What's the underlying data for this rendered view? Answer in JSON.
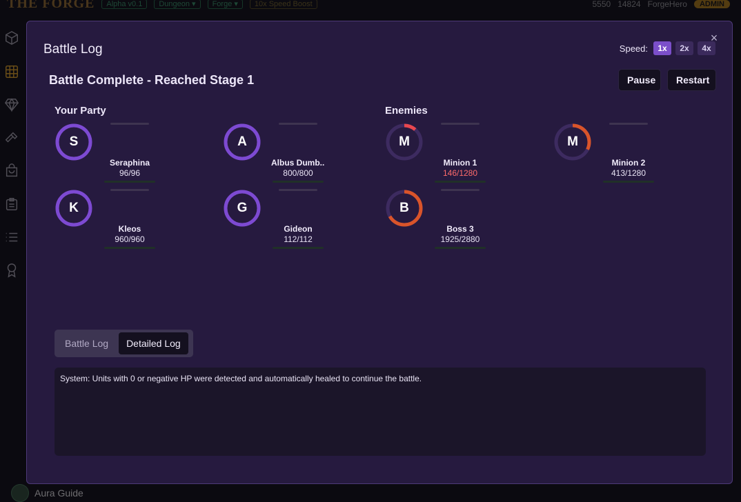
{
  "app": {
    "logo": "THE FORGE",
    "chips": [
      "Alpha v0.1",
      "Dungeon ▾",
      "Forge ▾",
      "10x Speed Boost"
    ],
    "gold": "5550",
    "gems": "14824",
    "user": "ForgeHero",
    "role_badge": "ADMIN",
    "guide_label": "Aura Guide"
  },
  "sidebar": {
    "items": [
      {
        "icon": "cube-icon"
      },
      {
        "icon": "grid-icon",
        "active": true
      },
      {
        "icon": "gem-icon"
      },
      {
        "icon": "hammer-icon"
      },
      {
        "icon": "bag-icon"
      },
      {
        "icon": "clipboard-icon"
      },
      {
        "icon": "list-icon"
      },
      {
        "icon": "award-icon"
      }
    ]
  },
  "modal": {
    "title": "Battle Log",
    "close_label": "×",
    "speed": {
      "label": "Speed:",
      "options": [
        "1x",
        "2x",
        "4x"
      ],
      "selected": "1x"
    },
    "status": "Battle Complete - Reached Stage 1",
    "pause_label": "Pause",
    "restart_label": "Restart",
    "party_title": "Your Party",
    "enemies_title": "Enemies",
    "party": [
      {
        "letter": "S",
        "name": "Seraphina",
        "hp": "96/96",
        "hp_fraction": 1.0
      },
      {
        "letter": "A",
        "name": "Albus Dumb...",
        "hp": "800/800",
        "hp_fraction": 1.0
      },
      {
        "letter": "K",
        "name": "Kleos",
        "hp": "960/960",
        "hp_fraction": 1.0
      },
      {
        "letter": "G",
        "name": "Gideon",
        "hp": "112/112",
        "hp_fraction": 1.0
      }
    ],
    "enemies": [
      {
        "letter": "M",
        "name": "Minion 1",
        "hp": "146/1280",
        "hp_fraction": 0.114,
        "low": true
      },
      {
        "letter": "M",
        "name": "Minion 2",
        "hp": "413/1280",
        "hp_fraction": 0.323,
        "low": false
      },
      {
        "letter": "B",
        "name": "Boss 3",
        "hp": "1925/2880",
        "hp_fraction": 0.668,
        "low": false
      }
    ],
    "tabs": [
      "Battle Log",
      "Detailed Log"
    ],
    "active_tab": "Detailed Log",
    "log_text": "System: Units with 0 or negative HP were detected and automatically healed to continue the battle."
  },
  "colors": {
    "party_ring": "#7d4ad2",
    "enemy_ring": "#d9542a",
    "enemy_ring_low": "#e8474f",
    "ring_track": "#3d2b60",
    "accent": "#7b4fc9"
  }
}
